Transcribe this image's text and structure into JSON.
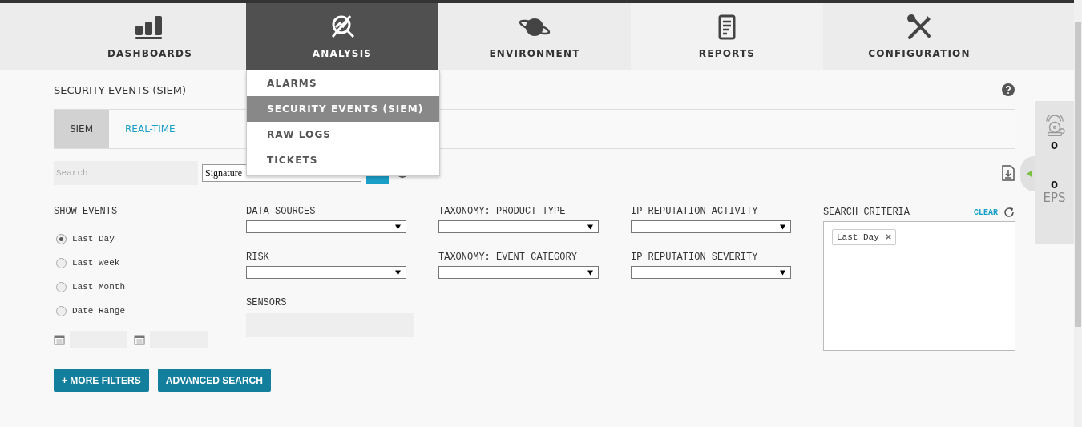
{
  "nav": [
    {
      "label": "DASHBOARDS",
      "kind": "chart",
      "selected": false
    },
    {
      "label": "ANALYSIS",
      "kind": "analysis",
      "selected": true
    },
    {
      "label": "ENVIRONMENT",
      "kind": "planet",
      "selected": false
    },
    {
      "label": "REPORTS",
      "kind": "report",
      "selected": false
    },
    {
      "label": "CONFIGURATION",
      "kind": "tools",
      "selected": false
    }
  ],
  "dropdown": [
    {
      "label": "ALARMS",
      "selected": false
    },
    {
      "label": "SECURITY EVENTS (SIEM)",
      "selected": true
    },
    {
      "label": "RAW LOGS",
      "selected": false
    },
    {
      "label": "TICKETS",
      "selected": false
    }
  ],
  "page_title": "SECURITY EVENTS (SIEM)",
  "subtabs": [
    {
      "label": "SIEM",
      "selected": true
    },
    {
      "label": "REAL-TIME",
      "selected": false
    }
  ],
  "search": {
    "placeholder": "Search",
    "field": "Signature"
  },
  "show_events": {
    "label": "SHOW EVENTS",
    "options": [
      {
        "label": "Last Day",
        "selected": true
      },
      {
        "label": "Last Week",
        "selected": false
      },
      {
        "label": "Last Month",
        "selected": false
      },
      {
        "label": "Date Range",
        "selected": false
      }
    ],
    "separator": "-"
  },
  "filters": [
    {
      "label": "DATA SOURCES",
      "kind": "select"
    },
    {
      "label": "TAXONOMY: PRODUCT TYPE",
      "kind": "select"
    },
    {
      "label": "IP REPUTATION ACTIVITY",
      "kind": "select"
    },
    {
      "label": "RISK",
      "kind": "select"
    },
    {
      "label": "TAXONOMY: EVENT CATEGORY",
      "kind": "select"
    },
    {
      "label": "IP REPUTATION SEVERITY",
      "kind": "select"
    },
    {
      "label": "SENSORS",
      "kind": "box"
    }
  ],
  "search_criteria": {
    "label": "SEARCH CRITERIA",
    "clear": "CLEAR",
    "tags": [
      "Last Day"
    ]
  },
  "buttons": [
    "+ MORE FILTERS",
    "ADVANCED SEARCH"
  ],
  "side_panel": {
    "alarms": "0",
    "eps_value": "0",
    "eps_label": "EPS"
  }
}
